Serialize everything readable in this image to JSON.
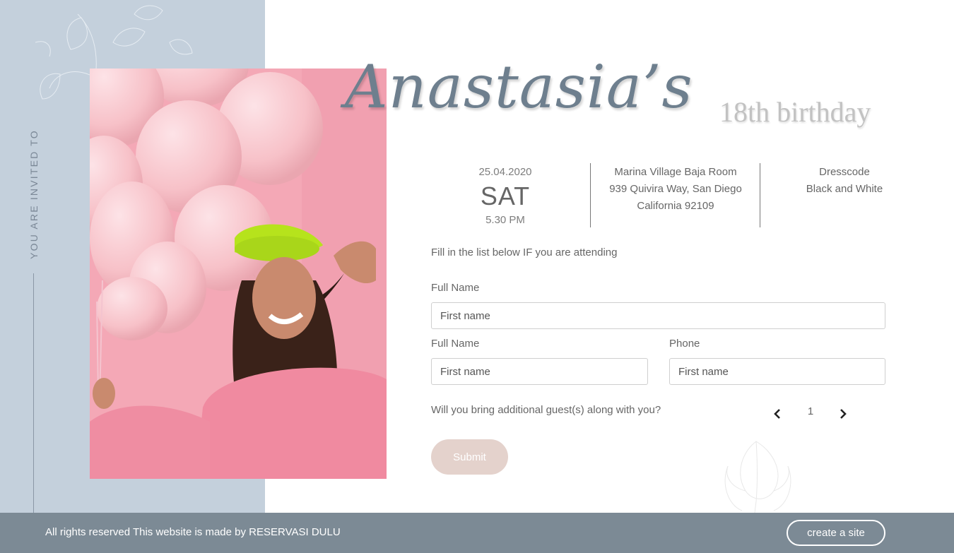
{
  "sidebar": {
    "invite_label": "YOU ARE INVITED TO"
  },
  "title": {
    "name": "Anastasia’s",
    "subtitle": "18th birthday"
  },
  "event": {
    "date": "25.04.2020",
    "day": "SAT",
    "time": "5.30 PM",
    "venue_line1": "Marina Village Baja Room",
    "venue_line2": "939 Quivira Way, San Diego",
    "venue_line3": "California 92109",
    "dresscode_label": "Dresscode",
    "dresscode_value": "Black and White"
  },
  "form": {
    "intro": "Fill in the list below IF you are attending",
    "full_name_label": "Full Name",
    "full_name_placeholder": "First name",
    "guest_name_label": "Full Name",
    "guest_name_placeholder": "First name",
    "phone_label": "Phone",
    "phone_placeholder": "First name",
    "guests_question": "Will you bring additional guest(s) along with you?",
    "guests_count": "1",
    "submit_label": "Submit"
  },
  "footer": {
    "text": "All rights reserved This website is made by RESERVASI DULU",
    "create_label": "create a site"
  },
  "colors": {
    "side_panel": "#c4d0dc",
    "footer": "#7c8a95",
    "submit": "#e4d2cc",
    "title": "#6e7f8e"
  }
}
